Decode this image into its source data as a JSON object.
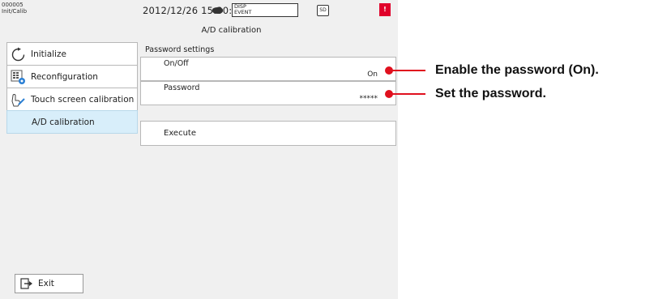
{
  "status_bar": {
    "id_line1": "000005",
    "id_line2": "Init/Calib",
    "datetime": "2012/12/26 15:30:13",
    "disp_label": "DISP",
    "event_label": "EVENT",
    "sd_label": "SD",
    "alarm_glyph": "!"
  },
  "screen_title": "A/D calibration",
  "menu": {
    "items": [
      {
        "label": "Initialize",
        "icon": "refresh-icon"
      },
      {
        "label": "Reconfiguration",
        "icon": "reconfiguration-icon"
      },
      {
        "label": "Touch screen calibration",
        "icon": "touch-pen-icon"
      },
      {
        "label": "A/D calibration",
        "icon": "",
        "selected": true
      }
    ]
  },
  "password_settings": {
    "group_label": "Password settings",
    "onoff": {
      "label": "On/Off",
      "value": "On"
    },
    "password": {
      "label": "Password",
      "value": "*****"
    }
  },
  "execute_label": "Execute",
  "exit_label": "Exit",
  "annotations": {
    "enable": "Enable the password (On).",
    "set": "Set the password."
  },
  "colors": {
    "accent_red": "#e0101e",
    "selected_bg": "#d8eefa",
    "panel_bg": "#f0f0f0"
  }
}
